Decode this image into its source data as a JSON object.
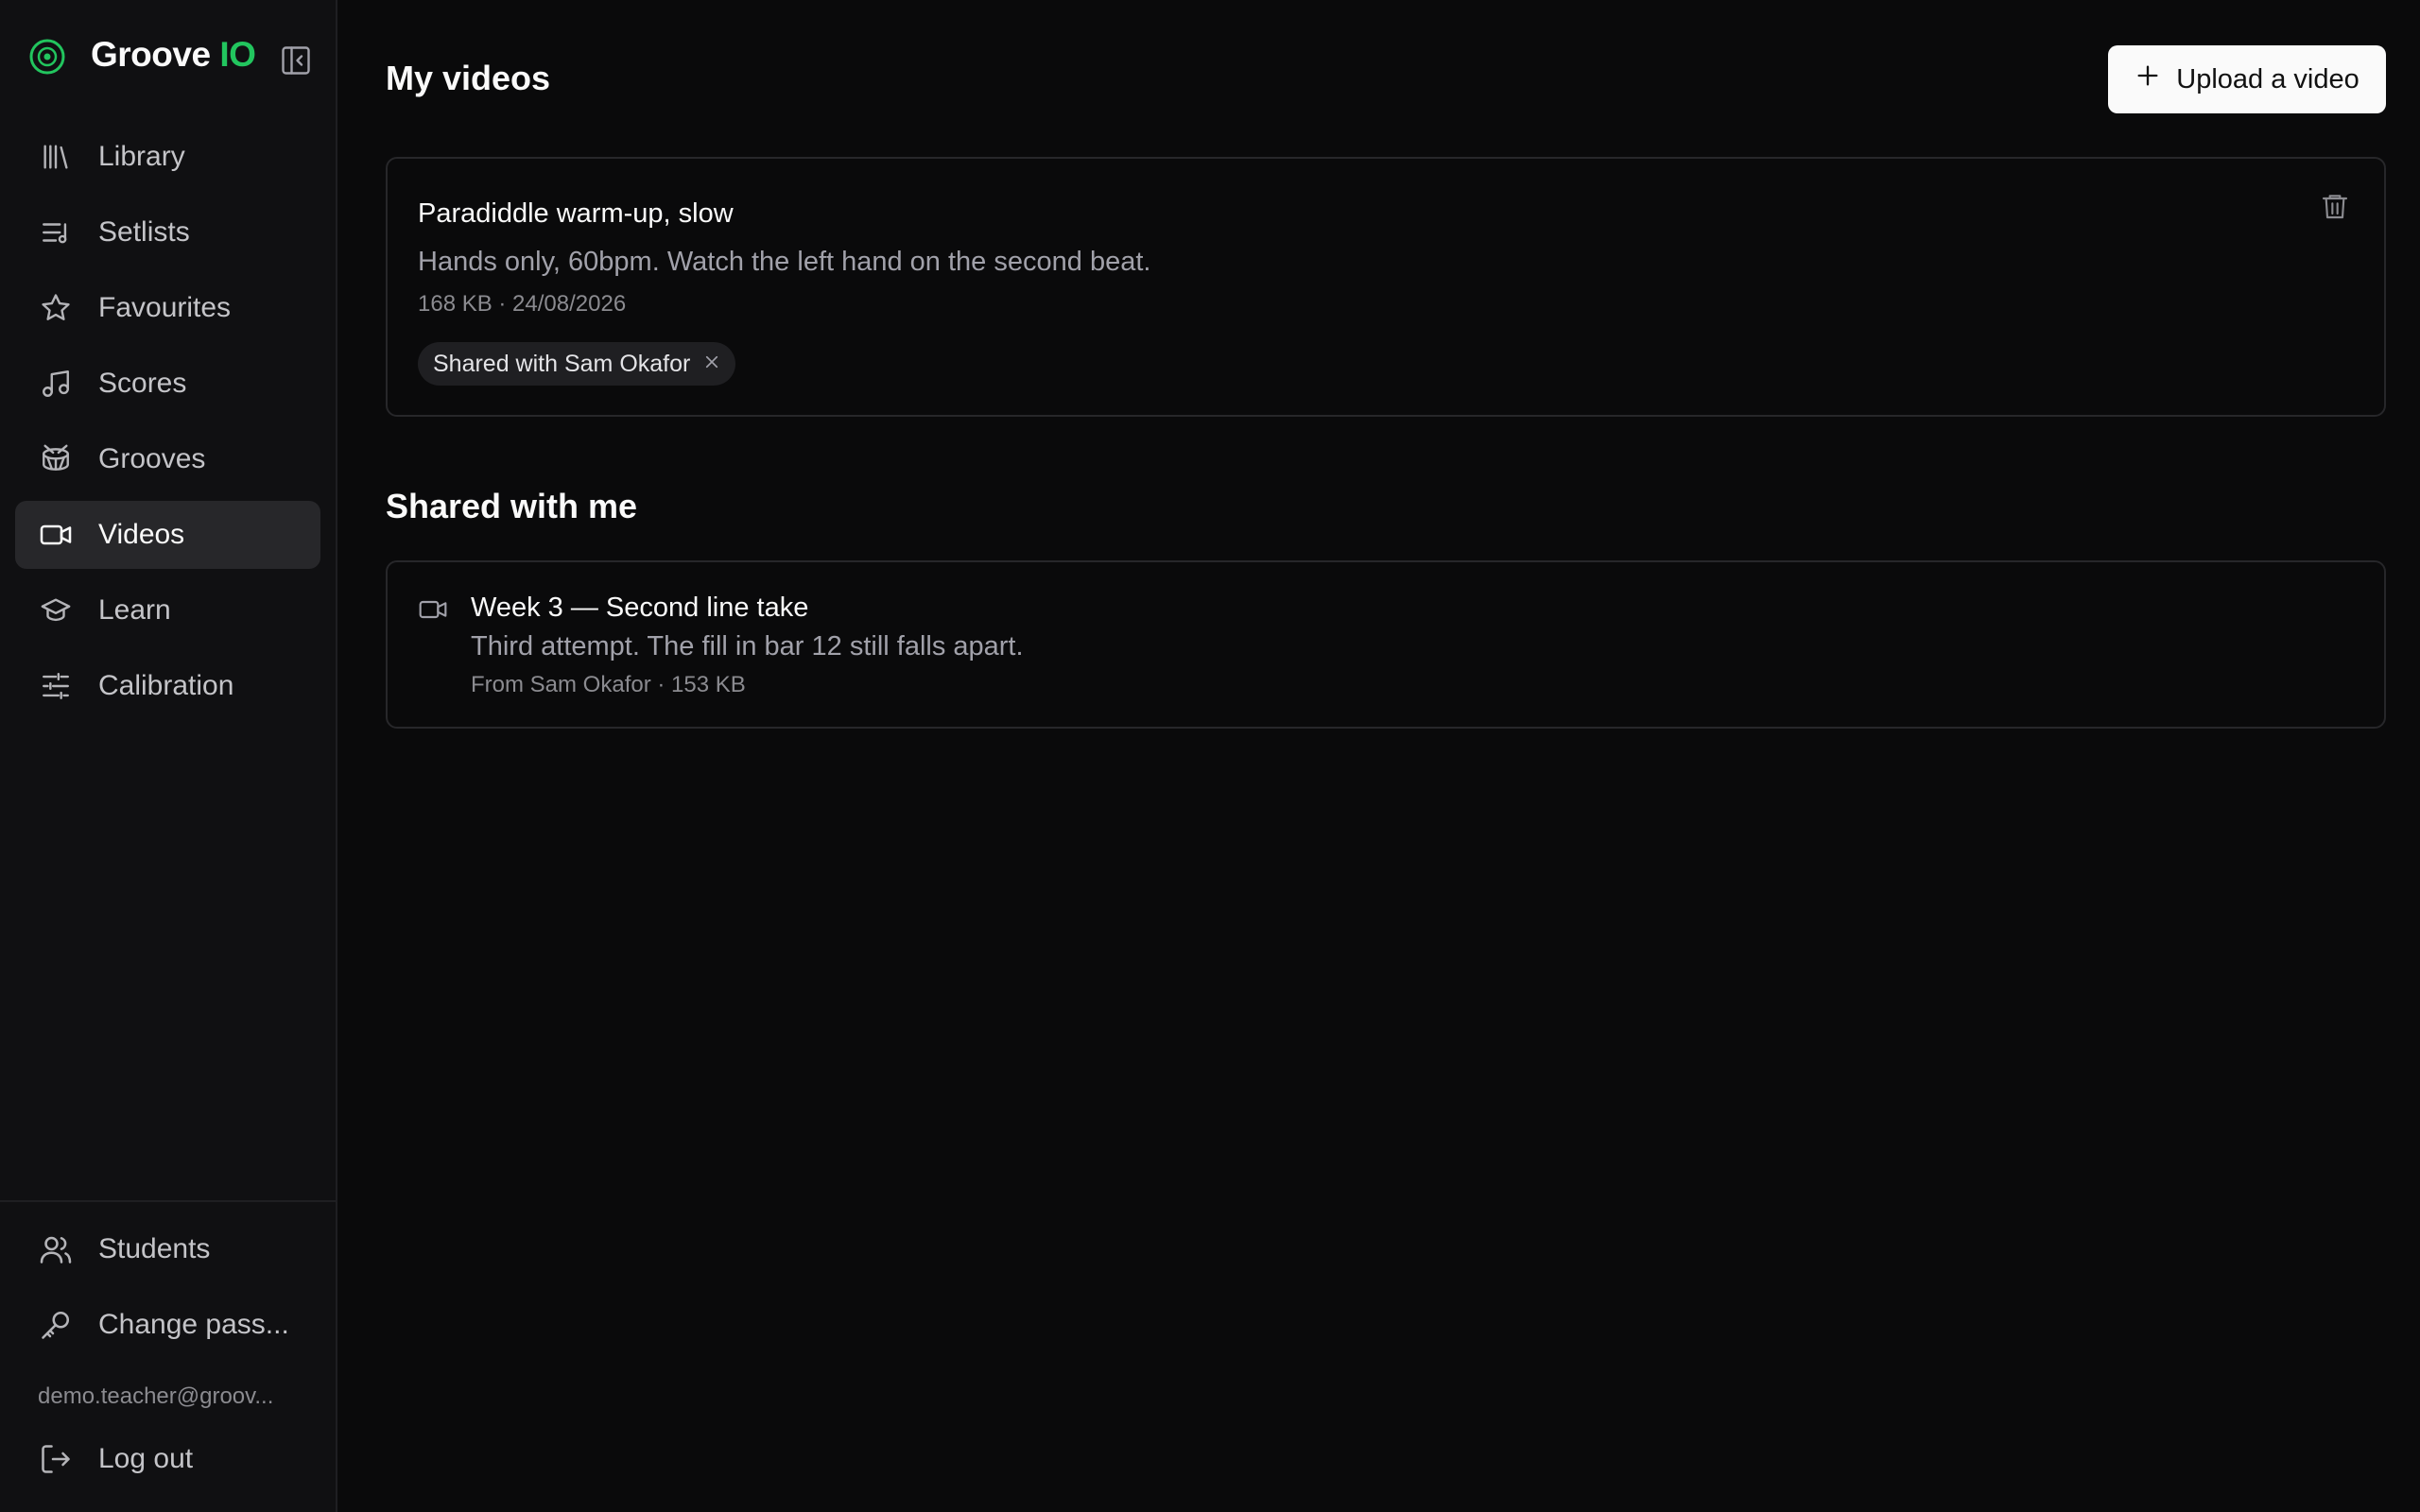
{
  "brand": {
    "name": "Groove",
    "suffix": "IO",
    "accent": "#22c55e"
  },
  "nav": {
    "items": [
      {
        "label": "Library",
        "icon": "library-icon"
      },
      {
        "label": "Setlists",
        "icon": "setlist-icon"
      },
      {
        "label": "Favourites",
        "icon": "star-icon"
      },
      {
        "label": "Scores",
        "icon": "music-note-icon"
      },
      {
        "label": "Grooves",
        "icon": "drum-icon"
      },
      {
        "label": "Videos",
        "icon": "video-icon",
        "active": true
      },
      {
        "label": "Learn",
        "icon": "graduation-cap-icon"
      },
      {
        "label": "Calibration",
        "icon": "sliders-icon"
      }
    ],
    "bottom": [
      {
        "label": "Students",
        "icon": "users-icon"
      },
      {
        "label": "Change pass...",
        "icon": "key-icon"
      }
    ],
    "user_email": "demo.teacher@groov...",
    "logout_label": "Log out"
  },
  "my_videos": {
    "title": "My videos",
    "upload_label": "Upload a video",
    "items": [
      {
        "title": "Paradiddle warm-up, slow",
        "description": "Hands only, 60bpm. Watch the left hand on the second beat.",
        "meta": "168 KB · 24/08/2026",
        "shared_with": "Shared with Sam Okafor"
      }
    ]
  },
  "shared_with_me": {
    "title": "Shared with me",
    "items": [
      {
        "title": "Week 3 — Second line take",
        "description": "Third attempt. The fill in bar 12 still falls apart.",
        "meta": "From Sam Okafor · 153 KB"
      }
    ]
  }
}
